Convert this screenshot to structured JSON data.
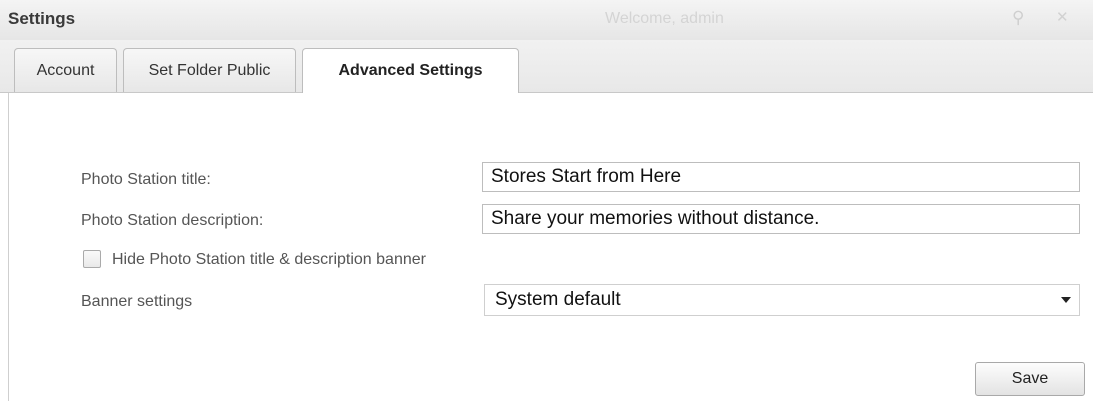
{
  "window": {
    "title": "Settings",
    "welcome_text": "Welcome, admin"
  },
  "tabs": [
    {
      "label": "Account",
      "active": false
    },
    {
      "label": "Set Folder Public",
      "active": false
    },
    {
      "label": "Advanced Settings",
      "active": true
    }
  ],
  "form": {
    "title_label": "Photo Station title:",
    "title_value": "Stores Start from Here",
    "description_label": "Photo Station description:",
    "description_value": "Share your memories without distance.",
    "hide_banner_label": "Hide Photo Station title & description banner",
    "hide_banner_checked": false,
    "banner_label": "Banner settings",
    "banner_value": "System default"
  },
  "actions": {
    "save_label": "Save"
  },
  "icons": {
    "search": "search-icon",
    "close": "close-icon",
    "dropdown": "chevron-down-icon"
  }
}
